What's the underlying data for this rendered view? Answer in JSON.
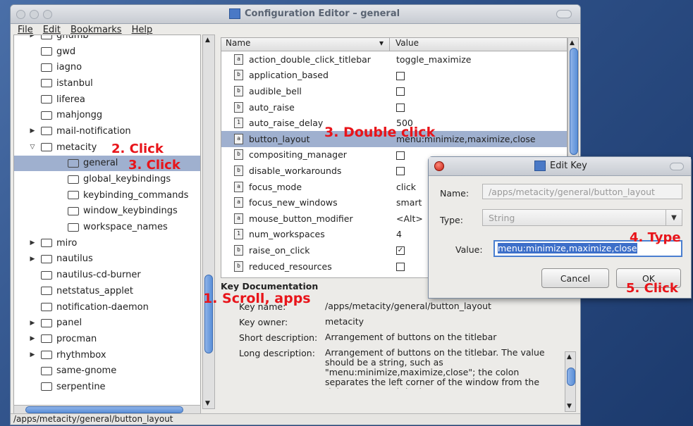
{
  "window": {
    "title": "Configuration Editor – general"
  },
  "menu": [
    "File",
    "Edit",
    "Bookmarks",
    "Help"
  ],
  "tree": [
    {
      "label": "gnumb",
      "exp": "▶",
      "indent": 1
    },
    {
      "label": "gwd",
      "exp": "",
      "indent": 1
    },
    {
      "label": "iagno",
      "exp": "",
      "indent": 1
    },
    {
      "label": "istanbul",
      "exp": "",
      "indent": 1
    },
    {
      "label": "liferea",
      "exp": "",
      "indent": 1
    },
    {
      "label": "mahjongg",
      "exp": "",
      "indent": 1
    },
    {
      "label": "mail-notification",
      "exp": "▶",
      "indent": 1
    },
    {
      "label": "metacity",
      "exp": "▽",
      "indent": 1
    },
    {
      "label": "general",
      "exp": "",
      "indent": 2,
      "selected": true
    },
    {
      "label": "global_keybindings",
      "exp": "",
      "indent": 2
    },
    {
      "label": "keybinding_commands",
      "exp": "",
      "indent": 2
    },
    {
      "label": "window_keybindings",
      "exp": "",
      "indent": 2
    },
    {
      "label": "workspace_names",
      "exp": "",
      "indent": 2
    },
    {
      "label": "miro",
      "exp": "▶",
      "indent": 1
    },
    {
      "label": "nautilus",
      "exp": "▶",
      "indent": 1
    },
    {
      "label": "nautilus-cd-burner",
      "exp": "",
      "indent": 1
    },
    {
      "label": "netstatus_applet",
      "exp": "",
      "indent": 1
    },
    {
      "label": "notification-daemon",
      "exp": "",
      "indent": 1
    },
    {
      "label": "panel",
      "exp": "▶",
      "indent": 1
    },
    {
      "label": "procman",
      "exp": "▶",
      "indent": 1
    },
    {
      "label": "rhythmbox",
      "exp": "▶",
      "indent": 1
    },
    {
      "label": "same-gnome",
      "exp": "",
      "indent": 1
    },
    {
      "label": "serpentine",
      "exp": "",
      "indent": 1
    }
  ],
  "list": {
    "col_name": "Name",
    "col_value": "Value",
    "rows": [
      {
        "name": "action_double_click_titlebar",
        "type": "a",
        "value": "toggle_maximize"
      },
      {
        "name": "application_based",
        "type": "b",
        "value": "",
        "check": " "
      },
      {
        "name": "audible_bell",
        "type": "b",
        "value": "",
        "check": " "
      },
      {
        "name": "auto_raise",
        "type": "b",
        "value": "",
        "check": " "
      },
      {
        "name": "auto_raise_delay",
        "type": "1",
        "value": "500"
      },
      {
        "name": "button_layout",
        "type": "a",
        "value": "menu:minimize,maximize,close",
        "selected": true
      },
      {
        "name": "compositing_manager",
        "type": "b",
        "value": "",
        "check": " "
      },
      {
        "name": "disable_workarounds",
        "type": "b",
        "value": "",
        "check": " "
      },
      {
        "name": "focus_mode",
        "type": "a",
        "value": "click"
      },
      {
        "name": "focus_new_windows",
        "type": "a",
        "value": "smart"
      },
      {
        "name": "mouse_button_modifier",
        "type": "a",
        "value": "<Alt>"
      },
      {
        "name": "num_workspaces",
        "type": "1",
        "value": "4"
      },
      {
        "name": "raise_on_click",
        "type": "b",
        "value": "",
        "check": "✓"
      },
      {
        "name": "reduced_resources",
        "type": "b",
        "value": "",
        "check": " "
      }
    ]
  },
  "doc": {
    "title": "Key Documentation",
    "key_name_label": "Key name:",
    "key_name": "/apps/metacity/general/button_layout",
    "key_owner_label": "Key owner:",
    "key_owner": "metacity",
    "short_label": "Short description:",
    "short": "Arrangement of buttons on the titlebar",
    "long_label": "Long description:",
    "long": "Arrangement of buttons on the titlebar. The value should be a string, such as \"menu:minimize,maximize,close\"; the colon separates the left corner of the window from the right corner, and the button names are comma-separated. Duplicate buttons are not allowed"
  },
  "status": "/apps/metacity/general/button_layout",
  "dialog": {
    "title": "Edit Key",
    "name_label": "Name:",
    "name_value": "/apps/metacity/general/button_layout",
    "type_label": "Type:",
    "type_value": "String",
    "value_label": "Value:",
    "value": "menu:minimize,maximize,close",
    "cancel": "Cancel",
    "ok": "OK"
  },
  "annotations": {
    "a1": "1. Scroll, apps",
    "a2": "2. Click",
    "a3": "3. Click",
    "a3b": "3. Double click",
    "a4": "4. Type",
    "a5": "5. Click"
  }
}
